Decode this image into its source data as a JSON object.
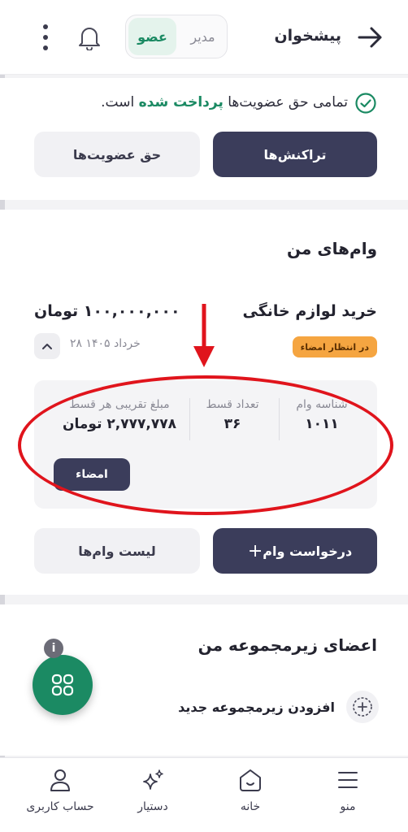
{
  "header": {
    "title": "پیشخوان",
    "roles": [
      "مدیر",
      "عضو"
    ],
    "active_role": "عضو"
  },
  "membership": {
    "status_prefix": "تمامی حق عضویت‌ها",
    "status_highlight": "پرداخت شده",
    "status_suffix": "است.",
    "transactions_label": "تراکنش‌ها",
    "dues_label": "حق عضویت‌ها"
  },
  "loans": {
    "title": "وام‌های من",
    "item": {
      "name": "خرید لوازم خانگی",
      "amount": "۱۰۰,۰۰۰,۰۰۰ تومان",
      "status": "در انتظار امضاء",
      "date": "۲۸ خرداد ۱۴۰۵",
      "loan_id_label": "شناسه وام",
      "loan_id": "۱۰۱۱",
      "installments_label": "تعداد قسط",
      "installments": "۳۶",
      "installment_amount_label": "مبلغ تقریبی هر قسط",
      "installment_amount": "۲,۷۷۷,۷۷۸ تومان",
      "sign_label": "امضاء"
    },
    "request_label": "درخواست وام",
    "list_label": "لیست وام‌ها"
  },
  "members": {
    "title": "اعضای زیرمجموعه من",
    "add_label": "افزودن زیرمجموعه جدید"
  },
  "info_badge": "i",
  "nav": {
    "menu": "منو",
    "home": "خانه",
    "assistant": "دستیار",
    "account": "حساب کاربری"
  },
  "colors": {
    "brand_green": "#1b8a63",
    "dark_button": "#3b3d5b",
    "badge_orange": "#f5a541",
    "annotation_red": "#e0141c"
  },
  "icons": {
    "back": "arrow-right-icon",
    "notifications": "bell-icon",
    "more": "kebab-icon",
    "paid": "check-circle-icon",
    "collapse": "chevron-up-icon",
    "add": "plus-circle-icon",
    "fab": "grid-icon",
    "menu": "hamburger-icon",
    "home": "home-icon",
    "assistant": "sparkle-icon",
    "account": "user-icon"
  }
}
